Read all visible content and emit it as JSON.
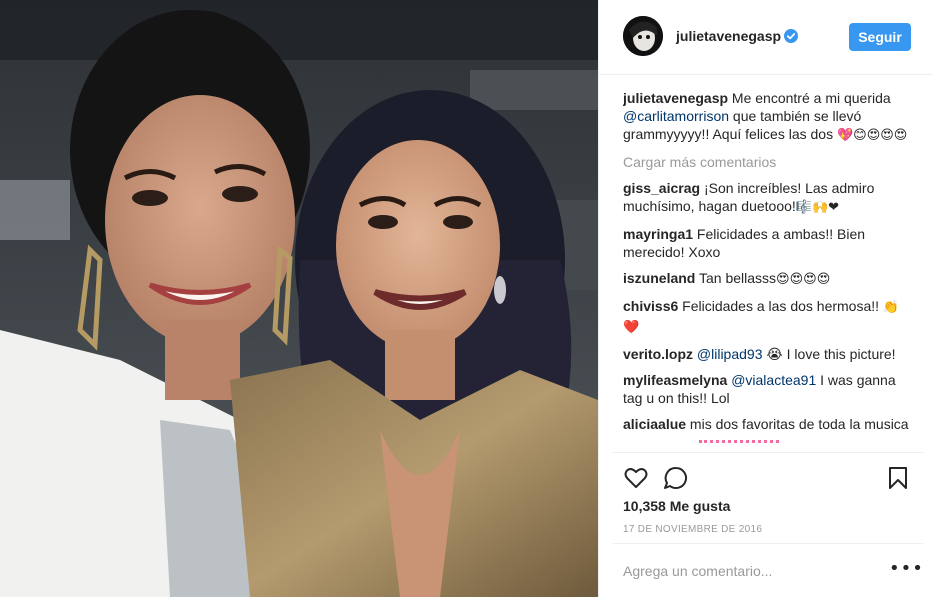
{
  "post": {
    "username": "julietavenegasp",
    "follow_label": "Seguir",
    "caption": {
      "username": "julietavenegasp",
      "text_1": " Me encontré a mi querida ",
      "mention": "@carlitamorrison",
      "text_2": " que también se llevó grammyyyyy!! Aquí felices las dos ",
      "emoji": "💖😊😍😍😍"
    },
    "load_more": "Cargar más comentarios",
    "comments": [
      {
        "user": "giss_aicrag",
        "text": " ¡Son increíbles! Las admiro muchísimo, hagan duetooo!",
        "emoji": "🎼🙌❤"
      },
      {
        "user": "mayringa1",
        "text": " Felicidades a ambas!! Bien merecido! Xoxo",
        "emoji": ""
      },
      {
        "user": "iszuneland",
        "text": " Tan bellasss",
        "emoji": "😍😍😍😍"
      },
      {
        "user": "chiviss6",
        "text": " Felicidades a las dos hermosa!! ",
        "emoji": "👏❤️"
      },
      {
        "user": "verito.lopz",
        "mention": "@lilipad93",
        "text": " 😭 I love this picture!"
      },
      {
        "user": "mylifeasmelyna",
        "mention": "@vialactea91",
        "text": " I was ganna tag u on this!! Lol"
      },
      {
        "user": "aliciaalue",
        "text": " mis dos favoritas de toda la musica",
        "emoji": ""
      }
    ],
    "likes": "10,358 Me gusta",
    "date": "17 DE NOVIEMBRE DE 2016",
    "comment_placeholder": "Agrega un comentario...",
    "more_options": "•••"
  },
  "icons": {
    "like": "heart-icon",
    "comment": "comment-bubble-icon",
    "save": "bookmark-icon",
    "verified": "verified-badge-icon",
    "more": "more-options-icon"
  },
  "colors": {
    "follow_button": "#3897f0",
    "mention": "#003569",
    "muted": "#999999",
    "divider": "#efefef",
    "verified": "#3897f0"
  }
}
